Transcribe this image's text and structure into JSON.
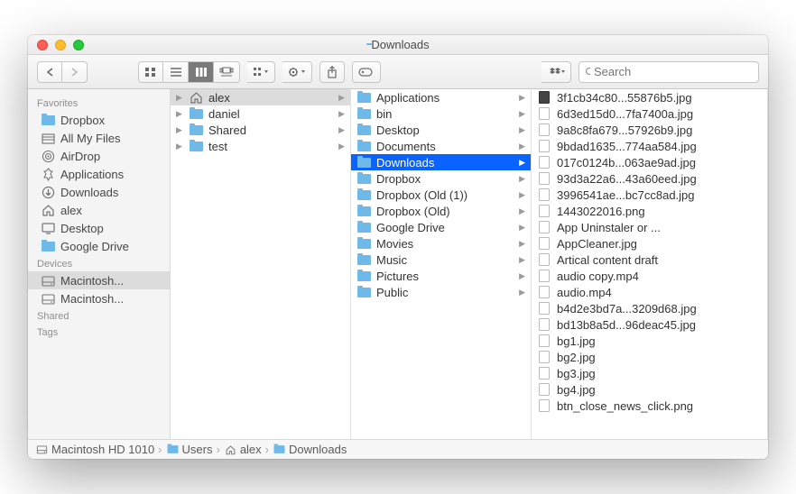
{
  "window": {
    "title": "Downloads"
  },
  "search": {
    "placeholder": "Search"
  },
  "sidebar": {
    "sections": [
      {
        "header": "Favorites",
        "items": [
          {
            "icon": "folder",
            "label": "Dropbox"
          },
          {
            "icon": "all-files",
            "label": "All My Files"
          },
          {
            "icon": "airdrop",
            "label": "AirDrop"
          },
          {
            "icon": "apps",
            "label": "Applications"
          },
          {
            "icon": "downloads",
            "label": "Downloads"
          },
          {
            "icon": "home",
            "label": "alex"
          },
          {
            "icon": "desktop",
            "label": "Desktop"
          },
          {
            "icon": "folder",
            "label": "Google Drive"
          }
        ]
      },
      {
        "header": "Devices",
        "items": [
          {
            "icon": "disk",
            "label": "Macintosh...",
            "selected": true
          },
          {
            "icon": "disk",
            "label": "Macintosh..."
          }
        ]
      },
      {
        "header": "Shared",
        "items": []
      },
      {
        "header": "Tags",
        "items": []
      }
    ]
  },
  "columns": [
    {
      "items": [
        {
          "icon": "home",
          "label": "alex",
          "expandable": true,
          "selected": "grey"
        },
        {
          "icon": "folder",
          "label": "daniel",
          "expandable": true
        },
        {
          "icon": "folder",
          "label": "Shared",
          "expandable": true
        },
        {
          "icon": "folder",
          "label": "test",
          "expandable": true
        }
      ]
    },
    {
      "items": [
        {
          "icon": "folder",
          "label": "Applications",
          "expandable": true
        },
        {
          "icon": "folder",
          "label": "bin",
          "expandable": true
        },
        {
          "icon": "folder",
          "label": "Desktop",
          "expandable": true
        },
        {
          "icon": "folder",
          "label": "Documents",
          "expandable": true
        },
        {
          "icon": "folder",
          "label": "Downloads",
          "expandable": true,
          "selected": "blue"
        },
        {
          "icon": "folder",
          "label": "Dropbox",
          "expandable": true
        },
        {
          "icon": "folder",
          "label": "Dropbox (Old (1))",
          "expandable": true
        },
        {
          "icon": "folder",
          "label": "Dropbox (Old)",
          "expandable": true
        },
        {
          "icon": "folder",
          "label": "Google Drive",
          "expandable": true
        },
        {
          "icon": "folder",
          "label": "Movies",
          "expandable": true
        },
        {
          "icon": "folder",
          "label": "Music",
          "expandable": true
        },
        {
          "icon": "folder",
          "label": "Pictures",
          "expandable": true
        },
        {
          "icon": "folder",
          "label": "Public",
          "expandable": true
        }
      ]
    },
    {
      "items": [
        {
          "icon": "image",
          "label": "3f1cb34c80...55876b5.jpg"
        },
        {
          "icon": "file",
          "label": "6d3ed15d0...7fa7400a.jpg"
        },
        {
          "icon": "file",
          "label": "9a8c8fa679...57926b9.jpg"
        },
        {
          "icon": "file",
          "label": "9bdad1635...774aa584.jpg"
        },
        {
          "icon": "file",
          "label": "017c0124b...063ae9ad.jpg"
        },
        {
          "icon": "file",
          "label": "93d3a22a6...43a60eed.jpg"
        },
        {
          "icon": "file",
          "label": "3996541ae...bc7cc8ad.jpg"
        },
        {
          "icon": "file",
          "label": "1443022016.png"
        },
        {
          "icon": "file",
          "label": "App Uninstaler or ..."
        },
        {
          "icon": "file",
          "label": "AppCleaner.jpg"
        },
        {
          "icon": "file",
          "label": "Artical content draft"
        },
        {
          "icon": "file",
          "label": "audio copy.mp4"
        },
        {
          "icon": "file",
          "label": "audio.mp4"
        },
        {
          "icon": "file",
          "label": "b4d2e3bd7a...3209d68.jpg"
        },
        {
          "icon": "file",
          "label": "bd13b8a5d...96deac45.jpg"
        },
        {
          "icon": "file",
          "label": "bg1.jpg"
        },
        {
          "icon": "file",
          "label": "bg2.jpg"
        },
        {
          "icon": "file",
          "label": "bg3.jpg"
        },
        {
          "icon": "file",
          "label": "bg4.jpg"
        },
        {
          "icon": "file",
          "label": "btn_close_news_click.png"
        }
      ]
    }
  ],
  "pathbar": [
    {
      "icon": "disk",
      "label": "Macintosh HD 1010"
    },
    {
      "icon": "folder",
      "label": "Users"
    },
    {
      "icon": "home",
      "label": "alex"
    },
    {
      "icon": "folder",
      "label": "Downloads"
    }
  ]
}
